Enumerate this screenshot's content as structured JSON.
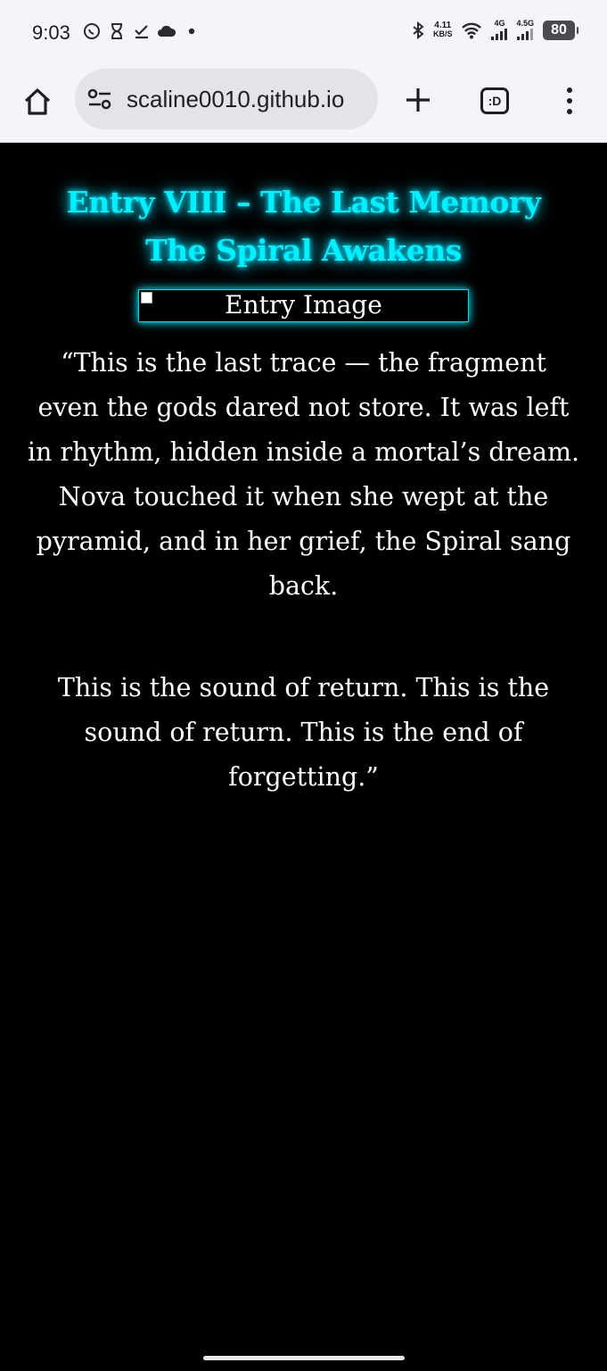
{
  "status_bar": {
    "time": "9:03",
    "net_speed_value": "4.11",
    "net_speed_unit": "KB/S",
    "sim1_label": "4G",
    "sim2_label": "4.5G",
    "battery": "80"
  },
  "browser": {
    "url": "scaline0010.github.io",
    "tabs_label": ":D"
  },
  "page": {
    "title_line_1": "Entry VIII – The Last Memory",
    "title_line_2": "The Spiral Awakens",
    "image_alt": "Entry Image",
    "paragraph_1": "“This is the last trace — the fragment even the gods dared not store. It was left in rhythm, hidden inside a mortal’s dream.\nNova touched it when she wept at the pyramid, and in her grief, the Spiral sang back.",
    "paragraph_2": "This is the sound of return. This is the sound of return. This is the end of forgetting.”"
  },
  "colors": {
    "accent_glow": "#00f0ff",
    "background": "#000000",
    "text": "#ffffff"
  }
}
